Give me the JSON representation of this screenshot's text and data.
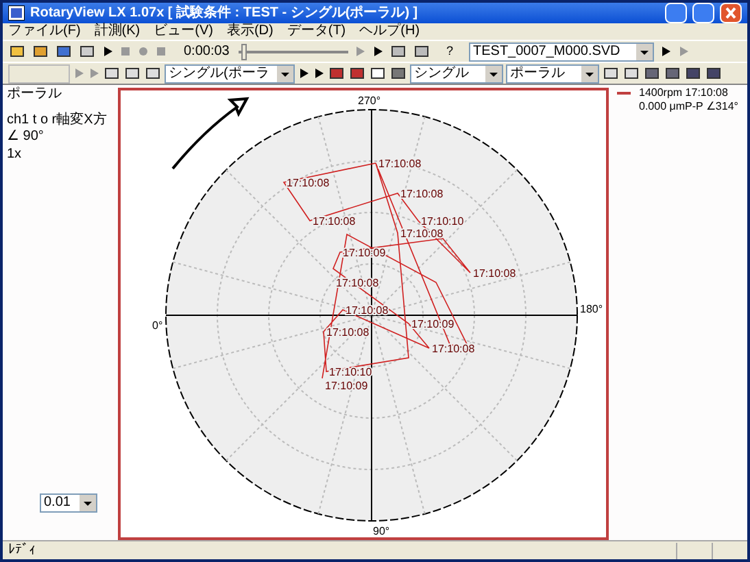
{
  "window": {
    "title": "RotaryView LX 1.07x [ 試験条件 : TEST - シングル(ポーラル) ]"
  },
  "menu": [
    "ファイル(F)",
    "計測(K)",
    "ビュー(V)",
    "表示(D)",
    "データ(T)",
    "ヘルプ(H)"
  ],
  "toolbar_1": {
    "time": "0:00:03",
    "seek": {
      "level": 0.02
    },
    "help": "?",
    "file_select": "TEST_0007_M000.SVD"
  },
  "toolbar_2": {
    "view_select": "シングル(ポーラ",
    "channel_select": "シングル",
    "mode_select": "ポーラル"
  },
  "left_panel": {
    "title": "ポーラル",
    "lines": [
      "ch1 t o r軸変X方",
      "∠ 90°",
      "1x"
    ],
    "scale_select": "0.01"
  },
  "plot": {
    "angle_labels": {
      "top": "270°",
      "bottom": "90°",
      "left": "0°",
      "right": "180°"
    },
    "point_labels": [
      "17:10:08",
      "17:10:08",
      "17:10:08",
      "17:10:08",
      "17:10:10",
      "17:10:08",
      "17:10:09",
      "17:10:08",
      "17:10:08",
      "17:10:08",
      "17:10:09",
      "17:10:08",
      "17:10:08",
      "17:10:10",
      "17:10:09"
    ]
  },
  "info": {
    "line_1": "1400rpm  17:10:08",
    "line_2": "0.000 μmP-P  ∠314°"
  },
  "status_bar": {
    "text": "ﾚﾃﾞｨ"
  }
}
